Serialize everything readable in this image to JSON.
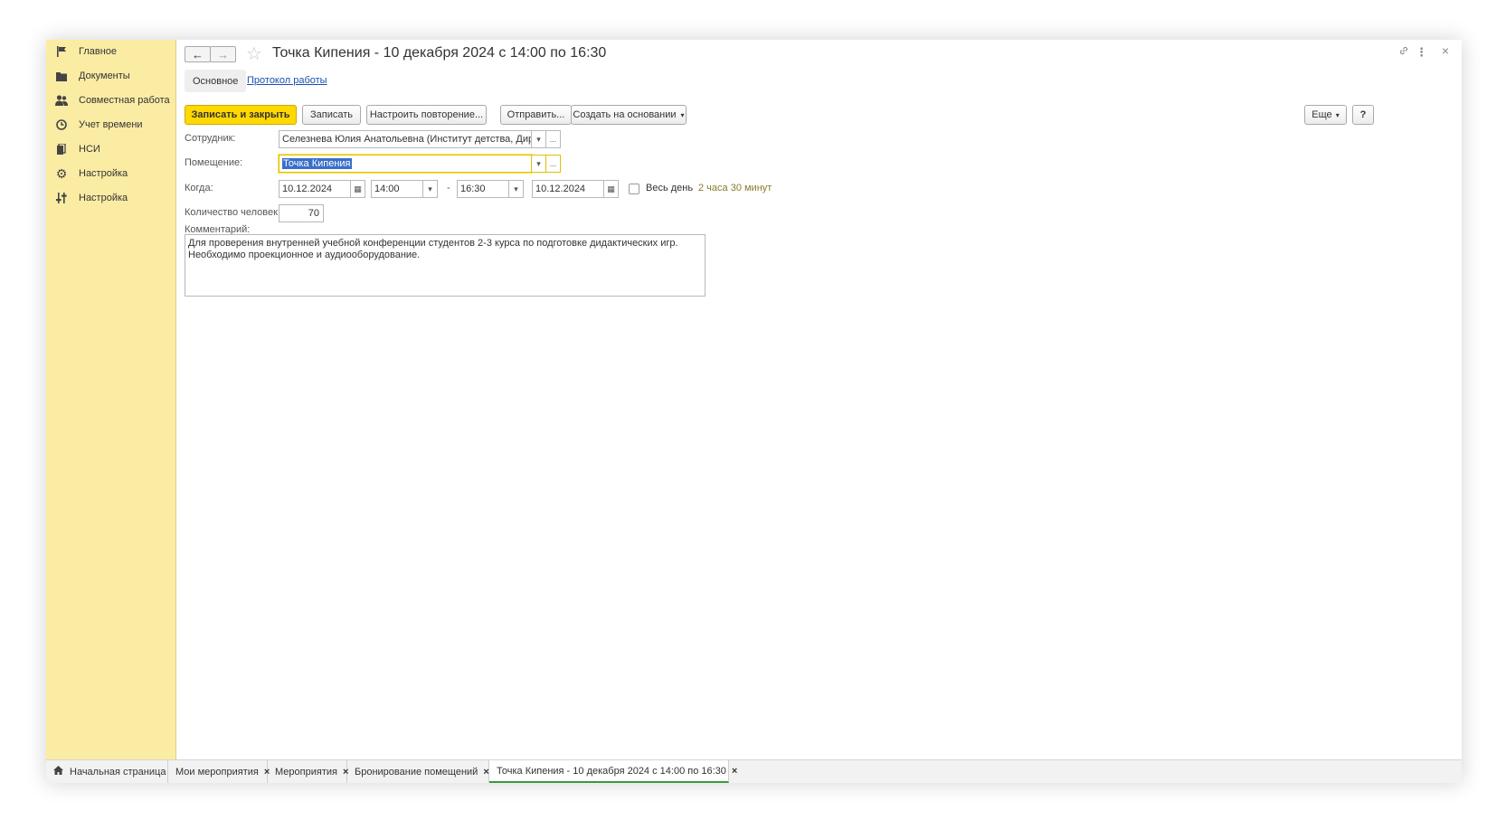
{
  "sidebar": {
    "items": [
      {
        "label": "Главное",
        "icon": "flag-icon"
      },
      {
        "label": "Документы",
        "icon": "folder-icon"
      },
      {
        "label": "Совместная работа",
        "icon": "users-icon"
      },
      {
        "label": "Учет времени",
        "icon": "clock-icon"
      },
      {
        "label": "НСИ",
        "icon": "books-icon"
      },
      {
        "label": "Настройка",
        "icon": "gear-icon"
      },
      {
        "label": "Настройка",
        "icon": "sliders-icon"
      }
    ]
  },
  "header": {
    "back": "←",
    "forward": "→",
    "star": "☆",
    "title": "Точка Кипения - 10 декабря 2024 с 14:00 по 16:30",
    "link_icon": "🔗",
    "menu_icon": "⋮",
    "close_icon": "×"
  },
  "tabs": {
    "main": "Основное",
    "log": "Протокол работы"
  },
  "toolbar": {
    "save_close": "Записать и закрыть",
    "save": "Записать",
    "repeat": "Настроить повторение...",
    "send": "Отправить...",
    "create_based": "Создать на основании",
    "more": "Еще",
    "help": "?"
  },
  "form": {
    "employee_label": "Сотрудник:",
    "employee_value": "Селезнева Юлия Анатольевна (Институт детства, Директор",
    "room_label": "Помещение:",
    "room_value": "Точка Кипения",
    "when_label": "Когда:",
    "date_from": "10.12.2024",
    "time_from": "14:00",
    "dash": "-",
    "time_to": "16:30",
    "date_to": "10.12.2024",
    "all_day": "Весь день",
    "duration": "2 часа 30 минут",
    "people_label": "Количество человек:",
    "people_value": "70",
    "comment_label": "Комментарий:",
    "comment_line1": "Для проверения внутренней учебной конференции студентов 2-3 курса по подготовке дидактических игр.",
    "comment_line2": "Необходимо проекционное и аудиооборудование.",
    "dropdown_glyph": "▾",
    "ellipsis_glyph": "...",
    "calendar_glyph": "▦"
  },
  "bottom_tabs": [
    {
      "label": "Начальная страница",
      "icon": "home-icon"
    },
    {
      "label": "Мои мероприятия",
      "close": "×"
    },
    {
      "label": "Мероприятия",
      "close": "×"
    },
    {
      "label": "Бронирование помещений",
      "close": "×"
    },
    {
      "label": "Точка Кипения - 10 декабря 2024 с 14:00 по 16:30",
      "close": "×"
    }
  ]
}
